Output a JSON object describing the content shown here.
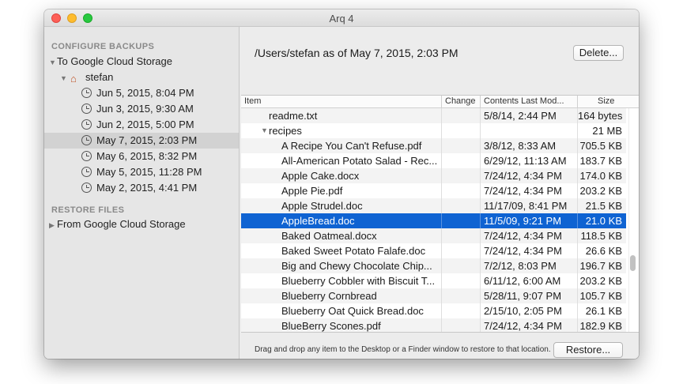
{
  "window": {
    "title": "Arq 4"
  },
  "sidebar": {
    "configure_header": "CONFIGURE BACKUPS",
    "destination": "To Google Cloud Storage",
    "folder": "stefan",
    "snapshots": [
      {
        "label": "Jun 5, 2015, 8:04 PM"
      },
      {
        "label": "Jun 3, 2015, 9:30 AM"
      },
      {
        "label": "Jun 2, 2015, 5:00 PM"
      },
      {
        "label": "May 7, 2015, 2:03 PM"
      },
      {
        "label": "May 6, 2015, 8:32 PM"
      },
      {
        "label": "May 5, 2015, 11:28 PM"
      },
      {
        "label": "May 2, 2015, 4:41 PM"
      }
    ],
    "restore_header": "RESTORE FILES",
    "restore_source": "From Google Cloud Storage"
  },
  "main": {
    "title": "/Users/stefan as of May 7, 2015, 2:03 PM",
    "delete_label": "Delete...",
    "columns": {
      "item": "Item",
      "change": "Change",
      "modified": "Contents Last Mod...",
      "size": "Size"
    },
    "rows": [
      {
        "name": "readme.txt",
        "change": "",
        "modified": "5/8/14, 2:44 PM",
        "size": "164 bytes"
      },
      {
        "name": "recipes",
        "change": "",
        "modified": "",
        "size": "21 MB"
      },
      {
        "name": "A Recipe You Can't Refuse.pdf",
        "change": "",
        "modified": "3/8/12, 8:33 AM",
        "size": "705.5 KB"
      },
      {
        "name": "All-American Potato Salad - Rec...",
        "change": "",
        "modified": "6/29/12, 11:13 AM",
        "size": "183.7 KB"
      },
      {
        "name": "Apple Cake.docx",
        "change": "",
        "modified": "7/24/12, 4:34 PM",
        "size": "174.0 KB"
      },
      {
        "name": "Apple Pie.pdf",
        "change": "",
        "modified": "7/24/12, 4:34 PM",
        "size": "203.2 KB"
      },
      {
        "name": "Apple Strudel.doc",
        "change": "",
        "modified": "11/17/09, 8:41 PM",
        "size": "21.5 KB"
      },
      {
        "name": "AppleBread.doc",
        "change": "",
        "modified": "11/5/09, 9:21 PM",
        "size": "21.0 KB"
      },
      {
        "name": "Baked Oatmeal.docx",
        "change": "",
        "modified": "7/24/12, 4:34 PM",
        "size": "118.5 KB"
      },
      {
        "name": "Baked Sweet Potato Falafe.doc",
        "change": "",
        "modified": "7/24/12, 4:34 PM",
        "size": "26.6 KB"
      },
      {
        "name": "Big and Chewy Chocolate Chip...",
        "change": "",
        "modified": "7/2/12, 8:03 PM",
        "size": "196.7 KB"
      },
      {
        "name": "Blueberry Cobbler with Biscuit T...",
        "change": "",
        "modified": "6/11/12, 6:00 AM",
        "size": "203.2 KB"
      },
      {
        "name": "Blueberry Cornbread",
        "change": "",
        "modified": "5/28/11, 9:07 PM",
        "size": "105.7 KB"
      },
      {
        "name": "Blueberry Oat Quick Bread.doc",
        "change": "",
        "modified": "2/15/10, 2:05 PM",
        "size": "26.1 KB"
      },
      {
        "name": "BlueBerry Scones.pdf",
        "change": "",
        "modified": "7/24/12, 4:34 PM",
        "size": "182.9 KB"
      }
    ],
    "hint": "Drag and drop any item to the Desktop or a Finder window to restore to that location.",
    "restore_label": "Restore..."
  },
  "colors": {
    "selection": "#0f63d2",
    "sidebar_selection": "#d2d2d2"
  }
}
